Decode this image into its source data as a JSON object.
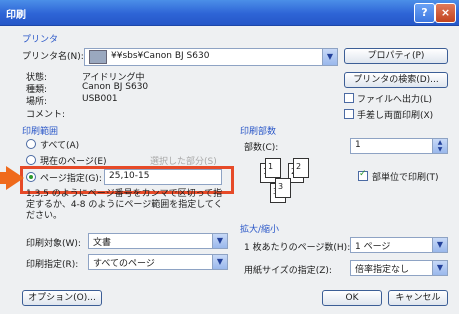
{
  "window": {
    "title": "印刷",
    "help_icon": "?",
    "close_icon": "×"
  },
  "printer": {
    "group_label": "プリンタ",
    "name_label": "プリンタ名(N):",
    "name_value": "¥¥sbs¥Canon BJ S630",
    "status_label": "状態:",
    "status_value": "アイドリング中",
    "type_label": "種類:",
    "type_value": "Canon BJ S630",
    "where_label": "場所:",
    "where_value": "USB001",
    "comment_label": "コメント:",
    "comment_value": "",
    "properties_button": "プロパティ(P)",
    "find_button": "プリンタの検索(D)...",
    "print_to_file": "ファイルへ出力(L)",
    "manual_duplex": "手差し両面印刷(X)"
  },
  "range": {
    "group_label": "印刷範囲",
    "all": "すべて(A)",
    "current": "現在のページ(E)",
    "selection": "選択した部分(S)",
    "pages": "ページ指定(G):",
    "pages_value": "25,10-15",
    "help_text": "1,3,5 のようにページ番号をカンマで区切って指定するか、4-8 のようにページ範囲を指定してください。"
  },
  "copies": {
    "group_label": "印刷部数",
    "count_label": "部数(C):",
    "count_value": "1",
    "collate": "部単位で印刷(T)"
  },
  "print_what": {
    "label": "印刷対象(W):",
    "value": "文書"
  },
  "print_pages": {
    "label": "印刷指定(R):",
    "value": "すべてのページ"
  },
  "zoom": {
    "group_label": "拡大/縮小",
    "pages_per_sheet_label": "1 枚あたりのページ数(H):",
    "pages_per_sheet_value": "1 ページ",
    "paper_size_label": "用紙サイズの指定(Z):",
    "paper_size_value": "倍率指定なし"
  },
  "buttons": {
    "options": "オプション(O)...",
    "ok": "OK",
    "cancel": "キャンセル"
  },
  "collate_pages": [
    "1",
    "1",
    "2",
    "2",
    "3",
    "3"
  ]
}
